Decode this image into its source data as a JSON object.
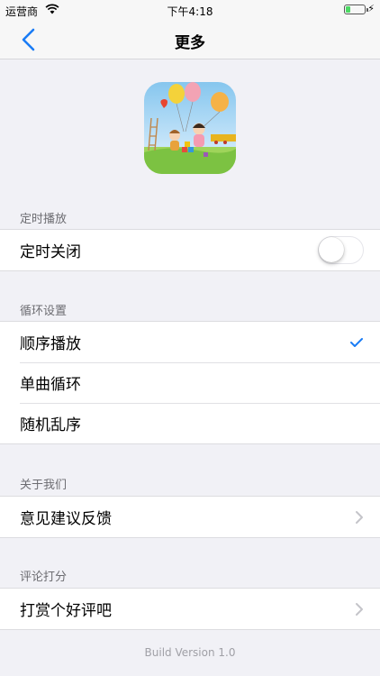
{
  "status_bar": {
    "carrier": "运营商",
    "time": "下午4:18",
    "battery_level": 0.25,
    "battery_color": "#4cd964"
  },
  "nav": {
    "title": "更多",
    "back_icon": "chevron-left-icon",
    "accent_color": "#1a7cf5"
  },
  "sections": {
    "timer": {
      "header": "定时播放",
      "rows": [
        {
          "label": "定时关闭",
          "toggle_on": false
        }
      ]
    },
    "loop": {
      "header": "循环设置",
      "rows": [
        {
          "label": "顺序播放",
          "checked": true
        },
        {
          "label": "单曲循环",
          "checked": false
        },
        {
          "label": "随机乱序",
          "checked": false
        }
      ]
    },
    "about": {
      "header": "关于我们",
      "rows": [
        {
          "label": "意见建议反馈",
          "icon": "chevron-right-icon"
        }
      ]
    },
    "rating": {
      "header": "评论打分",
      "rows": [
        {
          "label": "打赏个好评吧",
          "icon": "chevron-right-icon"
        }
      ]
    }
  },
  "footer": {
    "build": "Build Version 1.0"
  }
}
